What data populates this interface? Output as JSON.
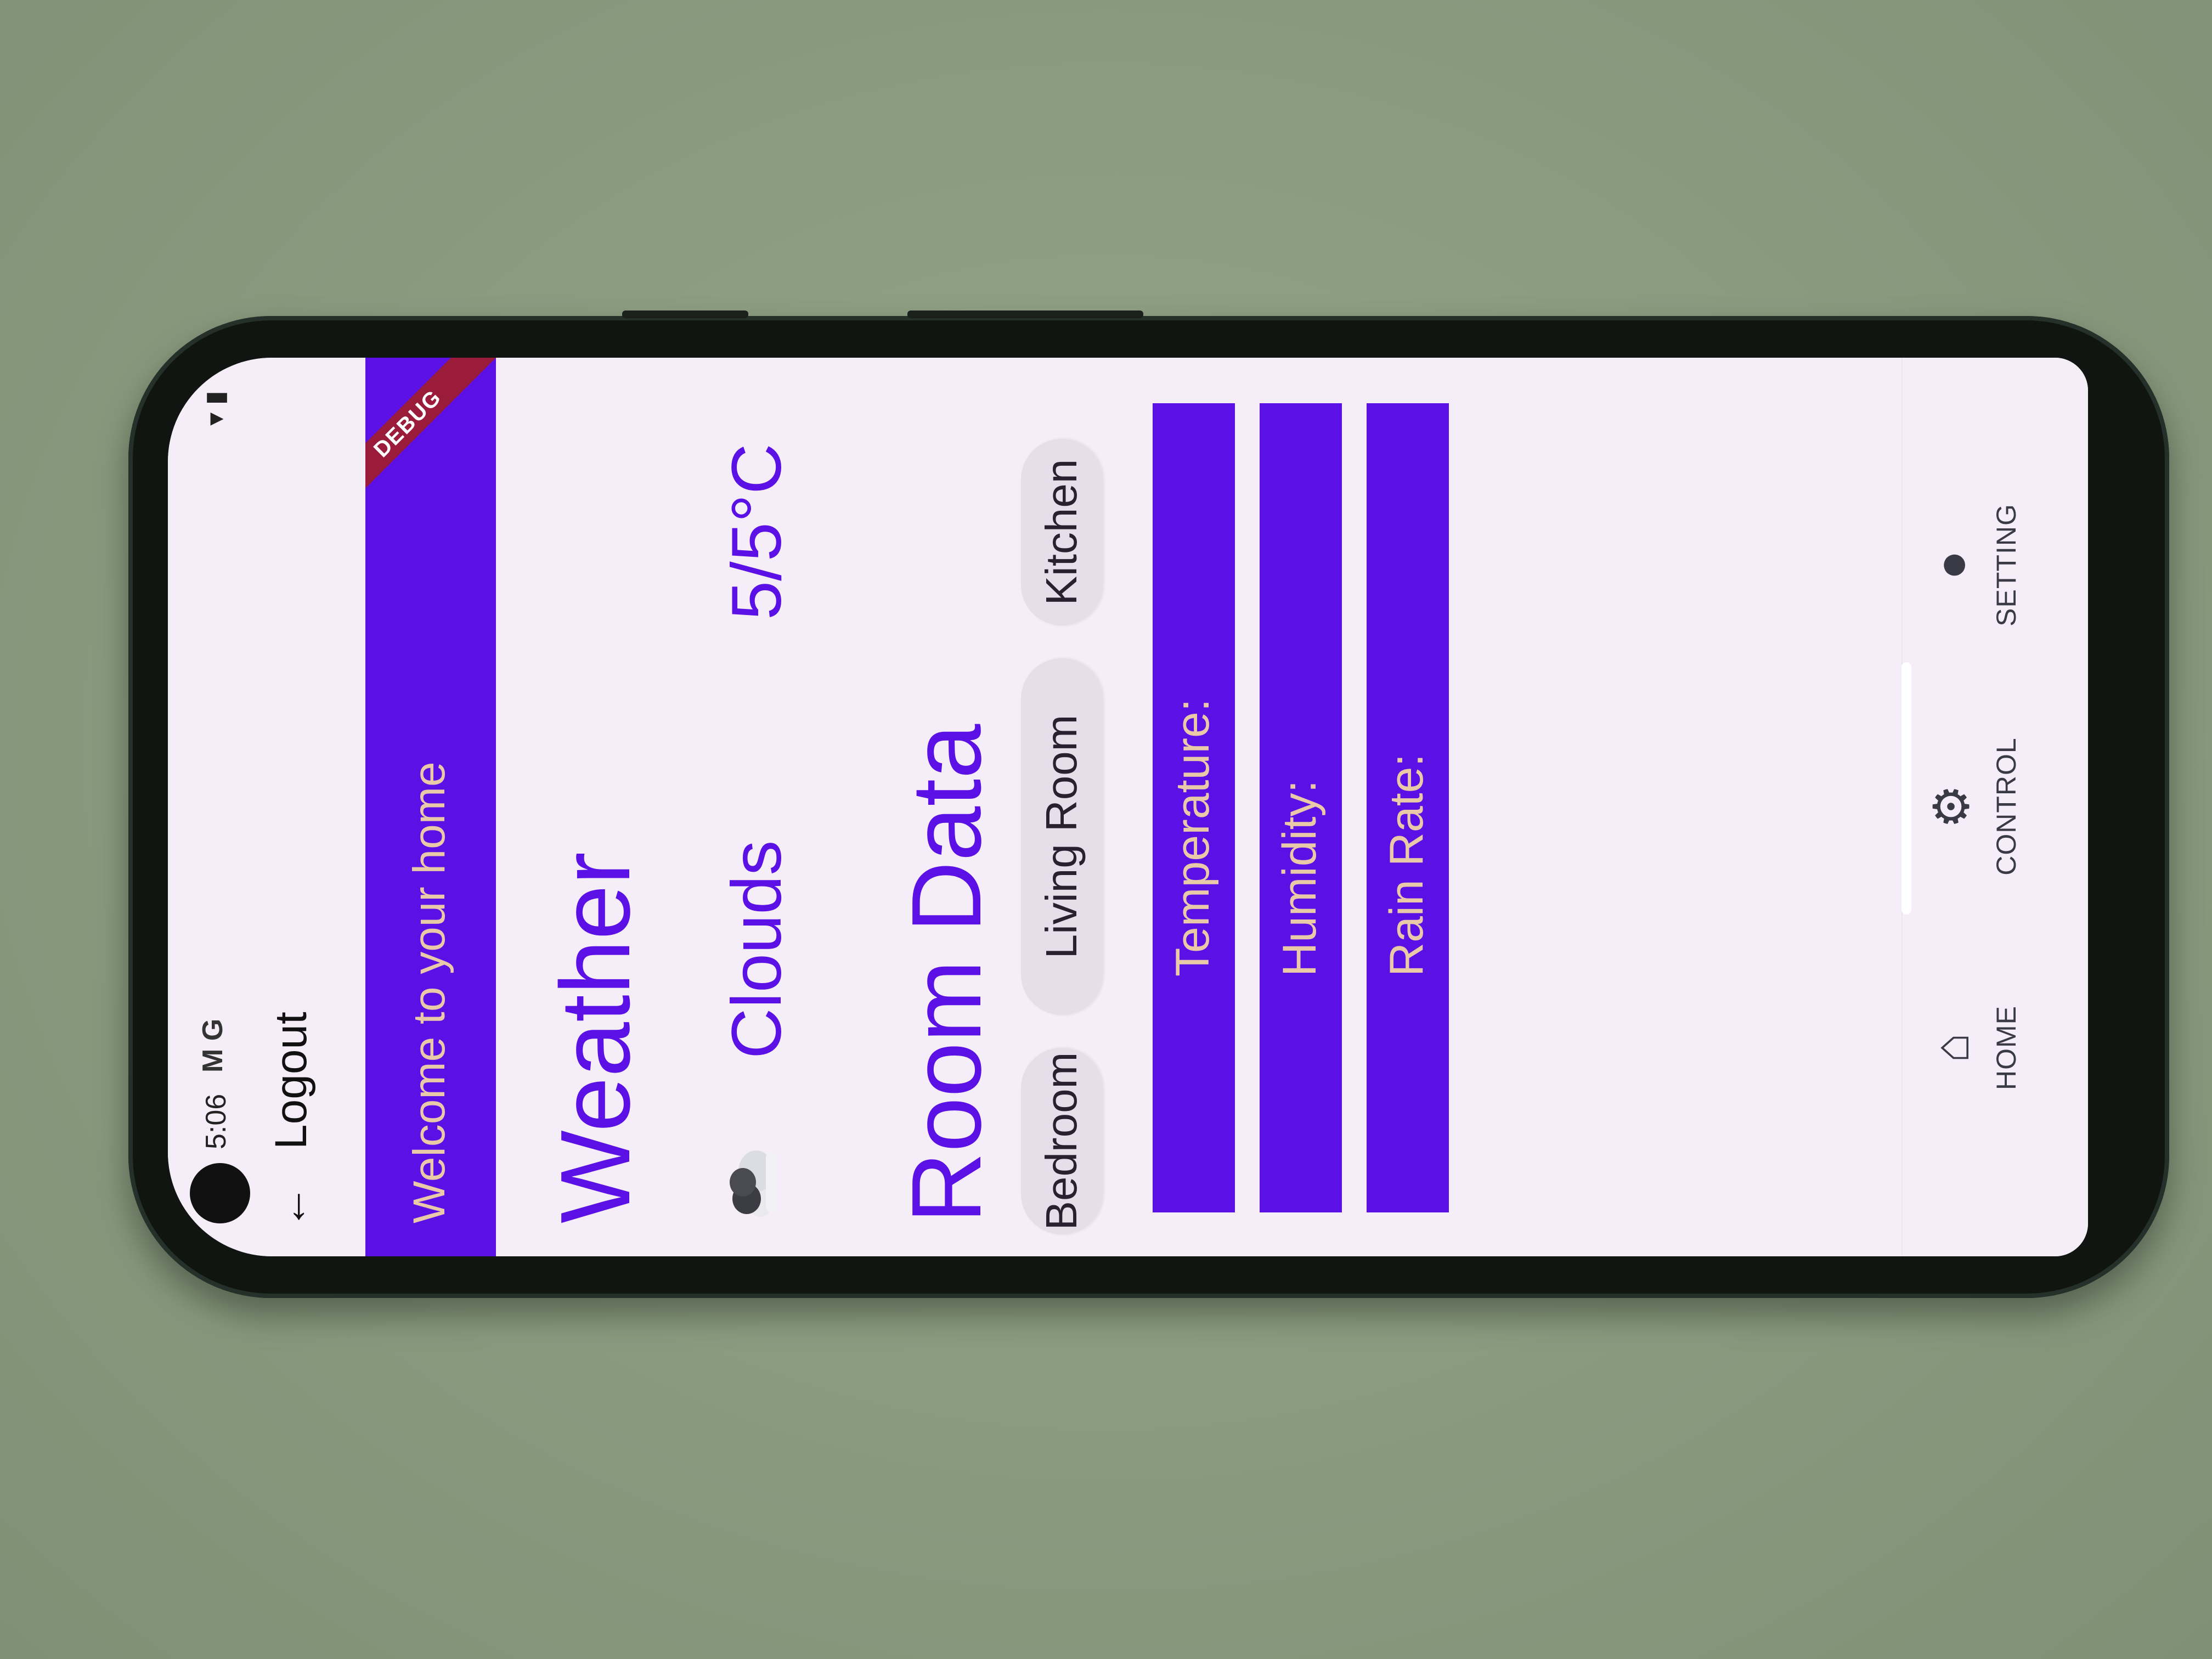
{
  "status_bar": {
    "time": "5:06",
    "left_icons": "M G",
    "right_icons": "▾ ▮"
  },
  "app_bar": {
    "back_icon": "←",
    "title": "Logout"
  },
  "banner": {
    "welcome": "Welcome to your home",
    "debug_label": "DEBUG"
  },
  "weather": {
    "title": "Weather",
    "description": "Clouds",
    "temperature": "5/5°C",
    "icon": "cloud-icon"
  },
  "room_data": {
    "title": "Room Data",
    "tabs": [
      {
        "label": "Bedroom"
      },
      {
        "label": "Living Room"
      },
      {
        "label": "Kitchen"
      }
    ],
    "metrics": [
      {
        "label": "Temperature:"
      },
      {
        "label": "Humidity:"
      },
      {
        "label": "Rain Rate:"
      }
    ]
  },
  "bottom_nav": {
    "items": [
      {
        "label": "HOME",
        "icon": "home-icon"
      },
      {
        "label": "CONTROL",
        "icon": "gear-icon"
      },
      {
        "label": "SETTING",
        "icon": "person-icon"
      }
    ]
  },
  "colors": {
    "accent": "#5b11e6",
    "banner_text": "#e8c9a8",
    "background": "#f5eef8",
    "debug": "#9b1b3a"
  }
}
